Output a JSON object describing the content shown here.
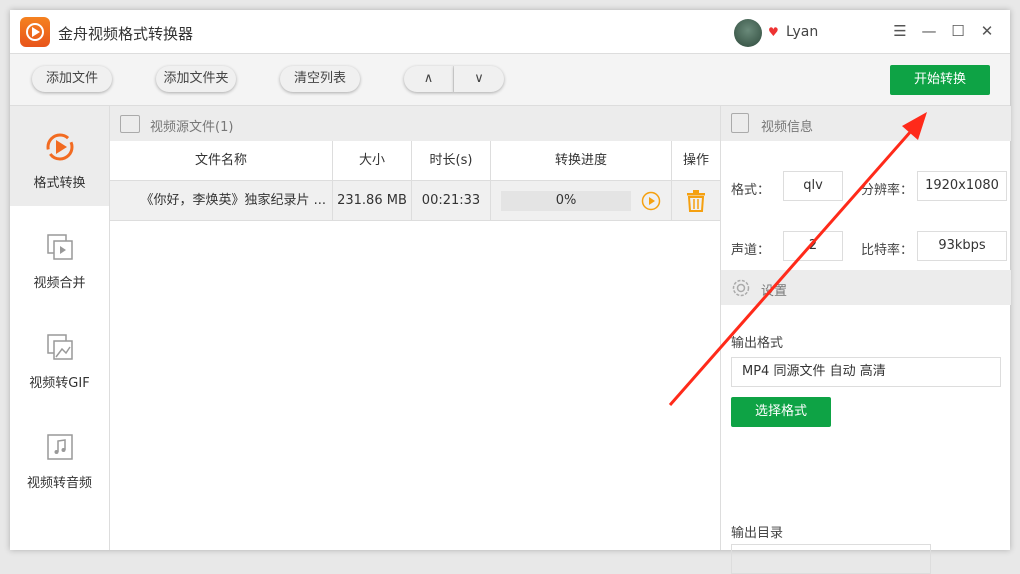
{
  "app": {
    "title": "金舟视频格式转换器",
    "user": "Lyan"
  },
  "toolbar": {
    "add_file": "添加文件",
    "add_folder": "添加文件夹",
    "clear_list": "清空列表",
    "up": "∧",
    "down": "∨",
    "start": "开始转换"
  },
  "sidebar": {
    "items": [
      {
        "label": "格式转换"
      },
      {
        "label": "视频合并"
      },
      {
        "label": "视频转GIF"
      },
      {
        "label": "视频转音频"
      }
    ]
  },
  "files": {
    "section_title": "视频源文件(1)",
    "columns": [
      "文件名称",
      "大小",
      "时长(s)",
      "转换进度",
      "操作"
    ],
    "rows": [
      {
        "name": "《你好，李焕英》独家纪录片 ...",
        "size": "231.86 MB",
        "duration": "00:21:33",
        "progress": "0%"
      }
    ]
  },
  "info": {
    "section_title": "视频信息",
    "format_label": "格式：",
    "format": "qlv",
    "resolution_label": "分辨率：",
    "resolution": "1920x1080",
    "channels_label": "声道：",
    "channels": "2",
    "bitrate_label": "比特率：",
    "bitrate": "93kbps"
  },
  "settings": {
    "section_title": "设置",
    "output_format_label": "输出格式",
    "output_format": "MP4 同源文件 自动 高清",
    "select_format": "选择格式",
    "output_dir_label": "输出目录"
  },
  "colors": {
    "accent": "#0ea345",
    "brand": "#f26b21",
    "arrow": "#ff2a1a"
  }
}
